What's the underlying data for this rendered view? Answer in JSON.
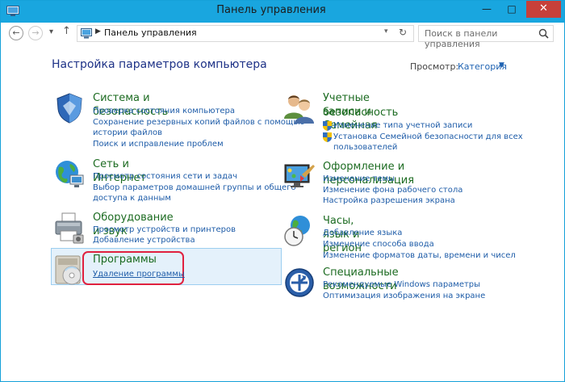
{
  "window": {
    "title": "Панель управления",
    "minimize": "—",
    "maximize": "□",
    "close": "✕",
    "accent": "#19a6df",
    "close_color": "#c7403a"
  },
  "address": {
    "back": "←",
    "forward": "→",
    "dropdown": "▾",
    "up": "↑",
    "separator": "▶",
    "path": "Панель управления",
    "path_dropdown": "▾",
    "refresh": "↻",
    "search_placeholder": "Поиск в панели управления"
  },
  "page": {
    "title": "Настройка параметров компьютера",
    "view_label": "Просмотр:",
    "view_value": "Категория",
    "view_arrow": "▼"
  },
  "categories": {
    "system": {
      "title": "Система и безопасность",
      "icon": "shield-icon",
      "links": [
        "Проверка состояния компьютера",
        "Сохранение резервных копий файлов с помощью",
        "истории файлов",
        "Поиск и исправление проблем"
      ]
    },
    "network": {
      "title": "Сеть и Интернет",
      "icon": "network-globe-icon",
      "links": [
        "Просмотр состояния сети и задач",
        "Выбор параметров домашней группы и общего",
        "доступа к данным"
      ]
    },
    "hardware": {
      "title": "Оборудование и звук",
      "icon": "printer-icon",
      "links": [
        "Просмотр устройств и принтеров",
        "Добавление устройства"
      ]
    },
    "programs": {
      "title": "Программы",
      "icon": "programs-disc-icon",
      "links": [
        "Удаление программы"
      ]
    },
    "accounts": {
      "title_line1": "Учетные записи и Семейная",
      "title_line2": "безопасность",
      "icon": "users-icon",
      "links": [
        "Изменение типа учетной записи",
        "Установка Семейной безопасности для всех",
        "пользователей"
      ]
    },
    "appearance": {
      "title": "Оформление и персонализация",
      "icon": "monitor-paint-icon",
      "links": [
        "Изменение темы",
        "Изменение фона рабочего стола",
        "Настройка разрешения экрана"
      ]
    },
    "clock": {
      "title": "Часы, язык и регион",
      "icon": "clock-globe-icon",
      "links": [
        "Добавление языка",
        "Изменение способа ввода",
        "Изменение форматов даты, времени и чисел"
      ]
    },
    "access": {
      "title": "Специальные возможности",
      "icon": "accessibility-icon",
      "links": [
        "Рекомендуемые Windows параметры",
        "Оптимизация изображения на экране"
      ]
    }
  },
  "colors": {
    "heading": "#1c6b21",
    "link": "#1e5ca8",
    "title": "#1e3287",
    "highlight_bg": "#e4f1fb",
    "red_annotation": "#e0213f"
  }
}
